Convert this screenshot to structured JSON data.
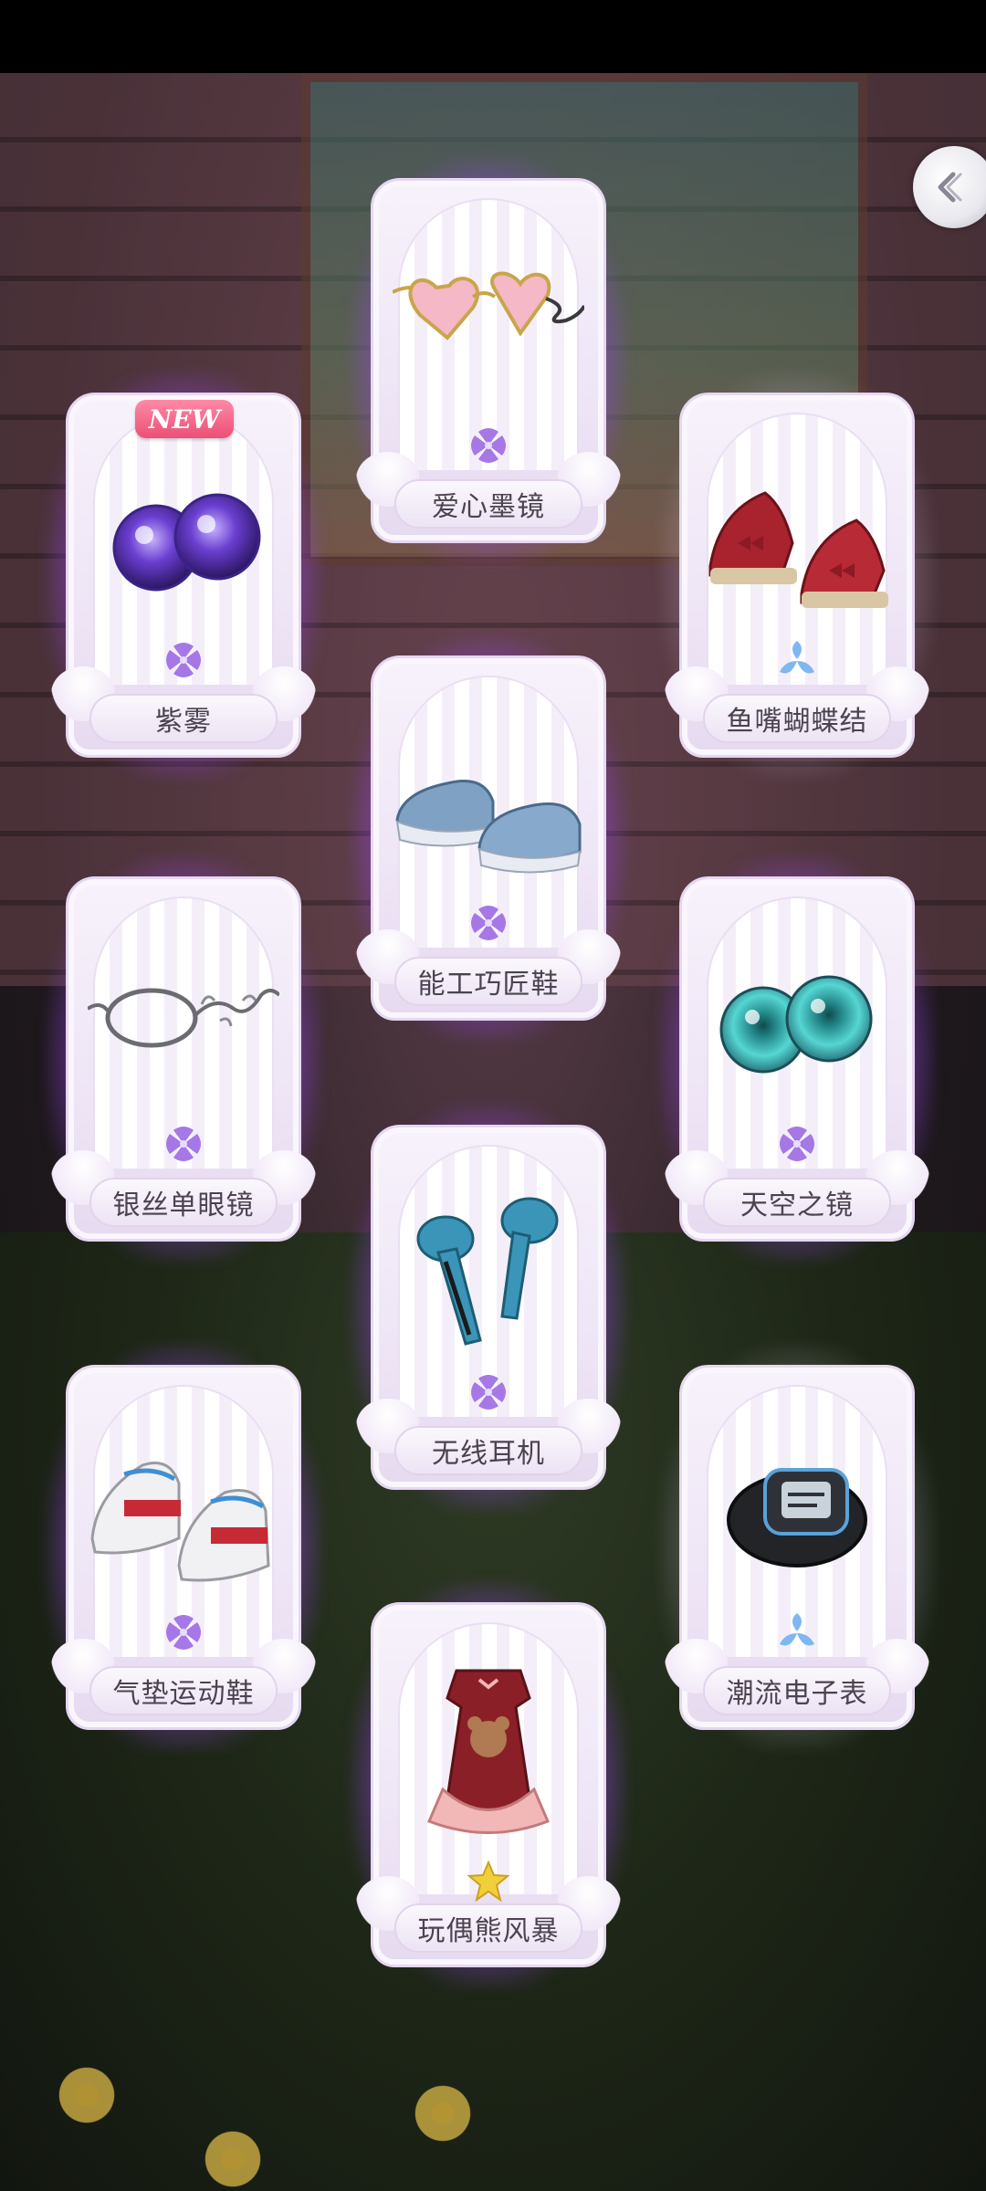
{
  "colors": {
    "purple_glow": "#a25af0",
    "rarity_purple": "#a678e6",
    "rarity_blue": "#7fb7f0",
    "rarity_gold": "#f2cf3a",
    "new_badge": "#ec4f76"
  },
  "back_button": {
    "icon": "back-chevron-icon"
  },
  "cards": [
    {
      "id": "zi-wu",
      "label": "紫雾",
      "rarity": "purple",
      "badge": "NEW",
      "item_icon": "purple-contact-lens-icon"
    },
    {
      "id": "aixin-mojing",
      "label": "爱心墨镜",
      "rarity": "purple",
      "badge": "",
      "item_icon": "heart-sunglasses-icon"
    },
    {
      "id": "yuzui-hudiejie",
      "label": "鱼嘴蝴蝶结",
      "rarity": "blue",
      "badge": "",
      "item_icon": "red-wedge-sandals-icon"
    },
    {
      "id": "nenggong-qiaojiangxie",
      "label": "能工巧匠鞋",
      "rarity": "purple",
      "badge": "",
      "item_icon": "blue-sneakers-icon"
    },
    {
      "id": "yinsi-danyanjing",
      "label": "银丝单眼镜",
      "rarity": "purple",
      "badge": "",
      "item_icon": "silver-monocle-icon"
    },
    {
      "id": "tiankong-zhijing",
      "label": "天空之镜",
      "rarity": "purple",
      "badge": "",
      "item_icon": "teal-contact-lens-icon"
    },
    {
      "id": "wuxian-erji",
      "label": "无线耳机",
      "rarity": "purple",
      "badge": "",
      "item_icon": "wireless-earbuds-icon"
    },
    {
      "id": "qidian-yundongxie",
      "label": "气垫运动鞋",
      "rarity": "purple",
      "badge": "",
      "item_icon": "white-sports-shoes-icon"
    },
    {
      "id": "chaoliu-dianzibiao",
      "label": "潮流电子表",
      "rarity": "blue",
      "badge": "",
      "item_icon": "digital-watch-icon"
    },
    {
      "id": "wanou-xiongfengbao",
      "label": "玩偶熊风暴",
      "rarity": "gold",
      "badge": "",
      "item_icon": "bear-dress-icon"
    }
  ]
}
